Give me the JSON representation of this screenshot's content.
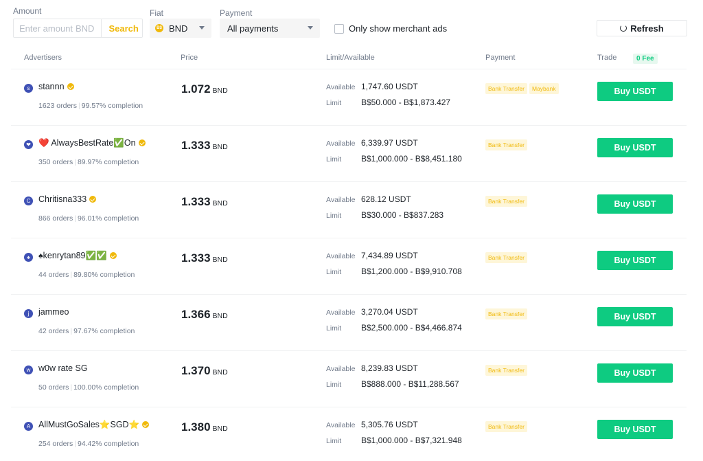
{
  "filters": {
    "amount_label": "Amount",
    "amount_placeholder": "Enter amount",
    "amount_unit": "BND",
    "search_label": "Search",
    "fiat_label": "Fiat",
    "fiat_coin": "B$",
    "fiat_value": "BND",
    "payment_label": "Payment",
    "payment_value": "All payments",
    "merchant_label": "Only show merchant ads",
    "refresh_label": "Refresh"
  },
  "table": {
    "headers": {
      "advertisers": "Advertisers",
      "price": "Price",
      "limit": "Limit/Available",
      "payment": "Payment",
      "trade": "Trade",
      "fee": "0 Fee"
    },
    "available_label": "Available",
    "limit_label": "Limit",
    "price_unit": "BND",
    "orders_suffix": "orders",
    "completion_suffix": "completion",
    "rows": [
      {
        "avatar": "s",
        "name": "stannn",
        "verified": true,
        "orders": "1623",
        "completion": "99.57%",
        "price": "1.072",
        "available": "1,747.60 USDT",
        "limit": "B$50.000 - B$1,873.427",
        "payments": [
          "Bank Transfer",
          "Maybank"
        ],
        "button": "Buy USDT"
      },
      {
        "avatar": "❤",
        "name": "❤️ AlwaysBestRate✅On",
        "verified": true,
        "orders": "350",
        "completion": "89.97%",
        "price": "1.333",
        "available": "6,339.97 USDT",
        "limit": "B$1,000.000 - B$8,451.180",
        "payments": [
          "Bank Transfer"
        ],
        "button": "Buy USDT"
      },
      {
        "avatar": "C",
        "name": "Chritisna333",
        "verified": true,
        "orders": "866",
        "completion": "96.01%",
        "price": "1.333",
        "available": "628.12 USDT",
        "limit": "B$30.000 - B$837.283",
        "payments": [
          "Bank Transfer"
        ],
        "button": "Buy USDT"
      },
      {
        "avatar": "♠",
        "name": "♠kenrytan89✅✅",
        "verified": true,
        "orders": "44",
        "completion": "89.80%",
        "price": "1.333",
        "available": "7,434.89 USDT",
        "limit": "B$1,200.000 - B$9,910.708",
        "payments": [
          "Bank Transfer"
        ],
        "button": "Buy USDT"
      },
      {
        "avatar": "j",
        "name": "jammeo",
        "verified": false,
        "orders": "42",
        "completion": "97.67%",
        "price": "1.366",
        "available": "3,270.04 USDT",
        "limit": "B$2,500.000 - B$4,466.874",
        "payments": [
          "Bank Transfer"
        ],
        "button": "Buy USDT"
      },
      {
        "avatar": "w",
        "name": "w0w rate SG",
        "verified": false,
        "orders": "50",
        "completion": "100.00%",
        "price": "1.370",
        "available": "8,239.83 USDT",
        "limit": "B$888.000 - B$11,288.567",
        "payments": [
          "Bank Transfer"
        ],
        "button": "Buy USDT"
      },
      {
        "avatar": "A",
        "name": "AllMustGoSales⭐SGD⭐",
        "verified": true,
        "orders": "254",
        "completion": "94.42%",
        "price": "1.380",
        "available": "5,305.76 USDT",
        "limit": "B$1,000.000 - B$7,321.948",
        "payments": [
          "Bank Transfer"
        ],
        "button": "Buy USDT"
      }
    ]
  },
  "colors": {
    "buy_green": "#0ecb81",
    "brand_yellow": "#f0b90b",
    "avatar_blue": "#3f51b5"
  }
}
